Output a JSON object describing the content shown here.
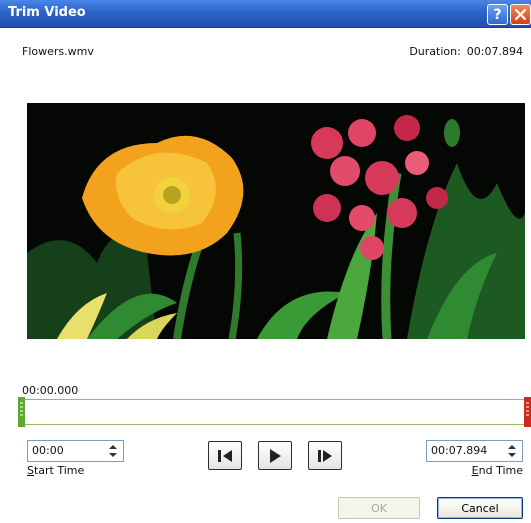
{
  "window": {
    "title": "Trim Video",
    "help_label": "?",
    "close_icon": "close-icon"
  },
  "file": {
    "name": "Flowers.wmv",
    "duration_label": "Duration:",
    "duration_value": "00:07.894"
  },
  "video": {
    "preview_icon": "video-preview-flowers"
  },
  "timeline": {
    "current_position": "00:00.000",
    "start_marker_color": "#5fa832",
    "end_marker_color": "#cf2a1e"
  },
  "start_time": {
    "value": "00:00",
    "label_hotkey": "S",
    "label_rest": "tart Time"
  },
  "end_time": {
    "value": "00:07.894",
    "label_hotkey": "E",
    "label_rest": "nd Time"
  },
  "playback": {
    "previous_frame_icon": "previous-frame-icon",
    "play_icon": "play-icon",
    "next_frame_icon": "next-frame-icon"
  },
  "footer": {
    "ok_label": "OK",
    "cancel_label": "Cancel"
  }
}
